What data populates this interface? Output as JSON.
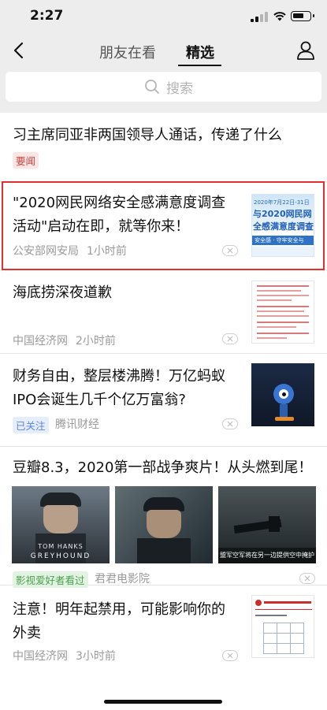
{
  "status": {
    "time": "2:27"
  },
  "nav": {
    "tab_following": "朋友在看",
    "tab_featured": "精选"
  },
  "search": {
    "placeholder": "搜索"
  },
  "feed": [
    {
      "title": "习主席同亚非两国领导人通话，传递了什么",
      "tag": "要闻"
    },
    {
      "title_line1": "\"2020网民网络安全感满意度调查",
      "title_line2": "活动\"启动在即，就等你来！",
      "source": "公安部网安局",
      "time": "1小时前",
      "thumb": {
        "date": "2020年7月22日-31日",
        "line1": "与2020网民网",
        "line2": "全感满意度调查",
        "footer": "安全感 · 守牢安全与"
      }
    },
    {
      "title": "海底捞深夜道歉",
      "source": "中国经济网",
      "time": "2小时前"
    },
    {
      "title_line1": "财务自由，整层楼沸腾！万亿蚂蚁",
      "title_line2": "IPO会诞生几千个亿万富翁?",
      "tag": "已关注",
      "source": "腾讯财经"
    },
    {
      "title": "豆瓣8.3，2020第一部战争爽片！从头燃到尾！",
      "tag": "影视爱好者看过",
      "source": "君君电影院",
      "images": [
        {
          "caption_line1": "TOM HANKS",
          "caption_line2": "GREYHOUND"
        },
        {},
        {
          "caption_line1": "盟军空军将在另一边提供空中掩护"
        }
      ]
    },
    {
      "title_line1": "注意！明年起禁用，可能影响你的",
      "title_line2": "外卖",
      "source": "中国经济网",
      "time": "3小时前"
    }
  ],
  "colors": {
    "highlight": "#e23030",
    "bar": "#ededed",
    "accent_red": "#d0453f",
    "accent_blue": "#5a86d6",
    "accent_green": "#4ba14b"
  }
}
